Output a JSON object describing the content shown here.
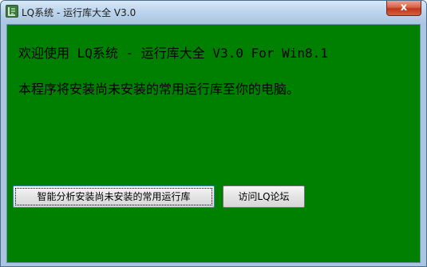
{
  "window": {
    "title": "LQ系统 - 运行库大全 V3.0",
    "close_glyph": "x",
    "app_icon": "lq-app-icon"
  },
  "main": {
    "welcome": "欢迎使用 LQ系统 - 运行库大全 V3.0 For Win8.1",
    "description": "本程序将安装尚未安装的常用运行库至你的电脑。"
  },
  "buttons": {
    "analyze_install": "智能分析安装尚未安装的常用运行库",
    "visit_forum": "访问LQ论坛"
  },
  "colors": {
    "background": "#008000",
    "text": "#000000"
  }
}
